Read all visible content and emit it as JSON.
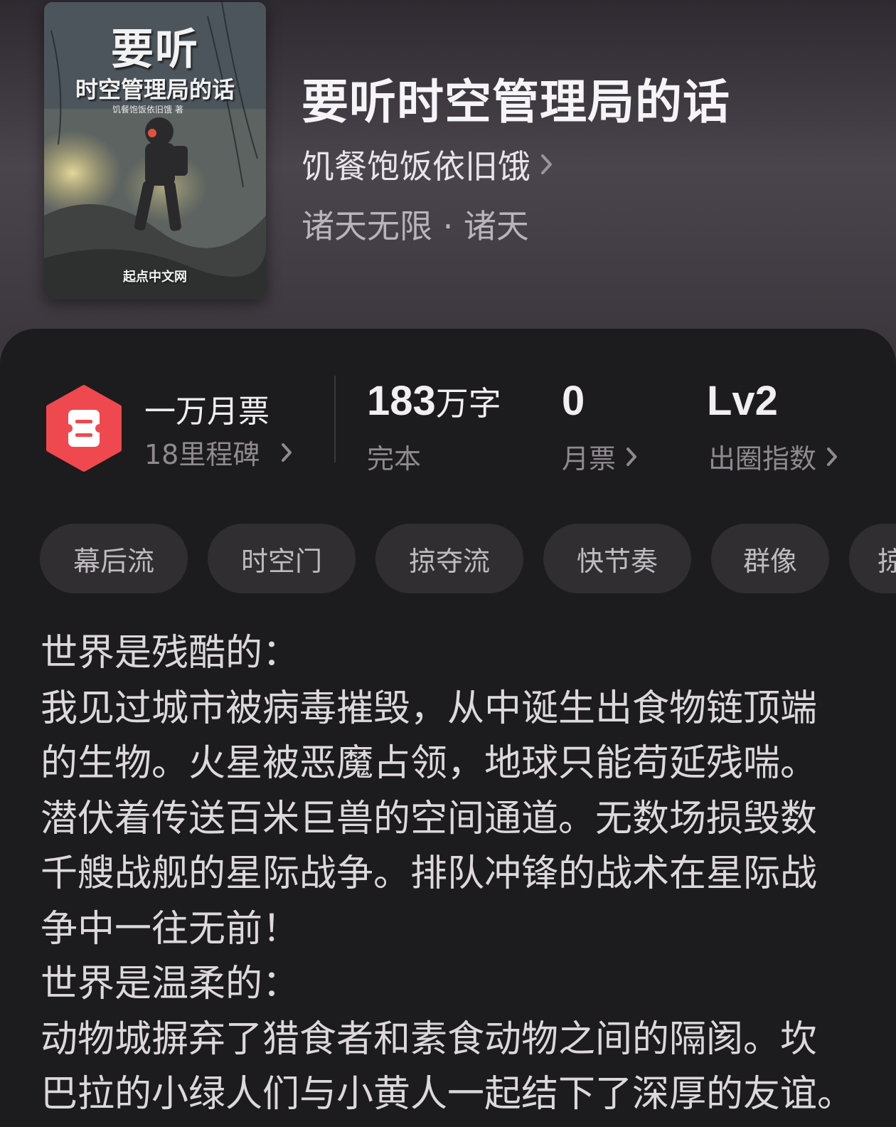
{
  "cover": {
    "title_line1": "要听",
    "title_line2": "时空管理局的话",
    "author_line": "饥餐饱饭依旧饿 著",
    "publisher": "起点中文网"
  },
  "book": {
    "title": "要听时空管理局的话",
    "author": "饥餐饱饭依旧饿",
    "genre": "诸天无限 · 诸天"
  },
  "stats": {
    "milestone_title": "一万月票",
    "milestone_sub": "18里程碑",
    "word_count_value": "183",
    "word_count_unit": "万字",
    "word_count_label": "完本",
    "monthly_ticket_value": "0",
    "monthly_ticket_label": "月票",
    "index_value": "Lv2",
    "index_label": "出圈指数"
  },
  "tags": [
    "幕后流",
    "时空门",
    "掠夺流",
    "快节奏",
    "群像",
    "掠"
  ],
  "synopsis": [
    "世界是残酷的：",
    "我见过城市被病毒摧毁，从中诞生出食物链顶端",
    "的生物。火星被恶魔占领，地球只能苟延残喘。",
    "潜伏着传送百米巨兽的空间通道。无数场损毁数",
    "千艘战舰的星际战争。排队冲锋的战术在星际战",
    "争中一往无前！",
    "世界是温柔的：",
    "动物城摒弃了猎食者和素食动物之间的隔阂。坎",
    "巴拉的小绿人们与小黄人一起结下了深厚的友谊。"
  ],
  "colors": {
    "badge_red": "#f0484f",
    "background": "#1c1b1d",
    "tag_bg": "#302e31"
  },
  "icons": {
    "badge": "ticket-hexagon-icon",
    "chevron": "chevron-right-icon"
  }
}
